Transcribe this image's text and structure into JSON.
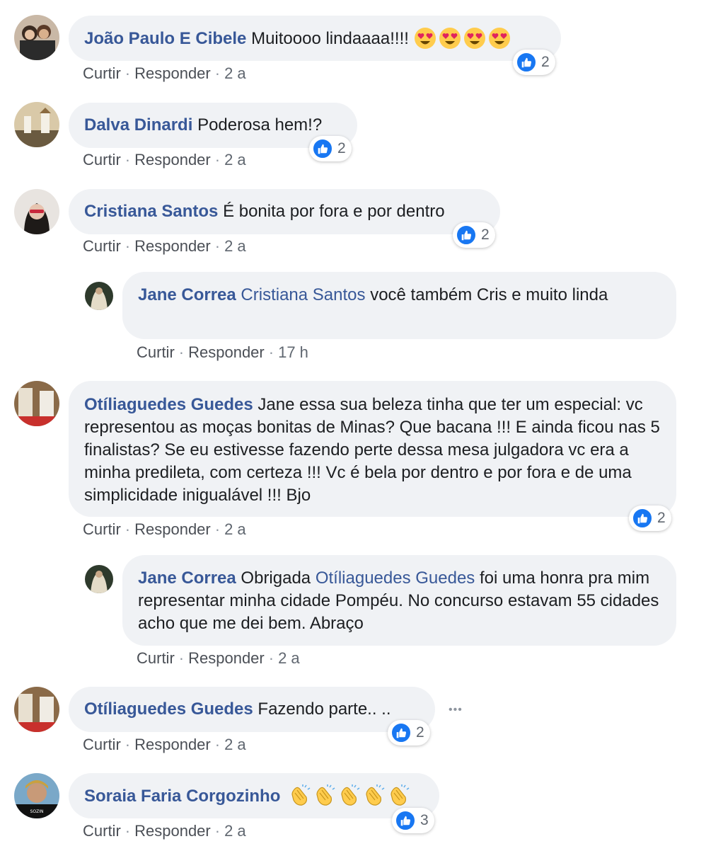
{
  "actions": {
    "like": "Curtir",
    "reply": "Responder",
    "sep": "·"
  },
  "comments": [
    {
      "author": "João Paulo E Cibele",
      "text": "Muitoooo lindaaaa!!!!",
      "time": "2 a",
      "likes": "2",
      "emojis": [
        "heart-eyes-emoji",
        "heart-eyes-emoji",
        "heart-eyes-emoji",
        "heart-eyes-emoji"
      ]
    },
    {
      "author": "Dalva Dinardi",
      "text": "Poderosa hem!?",
      "time": "2 a",
      "likes": "2"
    },
    {
      "author": "Cristiana Santos",
      "text": "É bonita por fora e por dentro",
      "time": "2 a",
      "likes": "2"
    },
    {
      "author": "Jane Correa",
      "tag": "Cristiana Santos",
      "text": "você também Cris e muito linda",
      "time": "17 h"
    },
    {
      "author": "Otíliaguedes Guedes",
      "text": "Jane essa sua beleza tinha que ter um especial: vc representou as moças bonitas de Minas? Que bacana !!! E ainda ficou nas 5 finalistas? Se eu estivesse fazendo perte dessa mesa julgadora vc era a minha predileta, com certeza !!! Vc é bela por dentro e por fora e de uma simplicidade inigualável !!! Bjo",
      "time": "2 a",
      "likes": "2"
    },
    {
      "author": "Jane Correa",
      "tag": "Otíliaguedes Guedes",
      "text": "foi uma honra pra mim representar minha cidade Pompéu. No concurso estavam 55 cidades acho que me dei bem. Abraço",
      "time": "2 a"
    },
    {
      "author": "Otíliaguedes Guedes",
      "text": "Fazendo parte.. ..",
      "time": "2 a",
      "likes": "2",
      "more": "•••"
    },
    {
      "author": "Soraia Faria Corgozinho",
      "text": "",
      "time": "2 a",
      "likes": "3",
      "emojis": [
        "clap-emoji",
        "clap-emoji",
        "clap-emoji",
        "clap-emoji",
        "clap-emoji"
      ]
    }
  ],
  "colors": {
    "name": "#385898",
    "bubble": "#f0f2f5",
    "like": "#1877f2"
  }
}
